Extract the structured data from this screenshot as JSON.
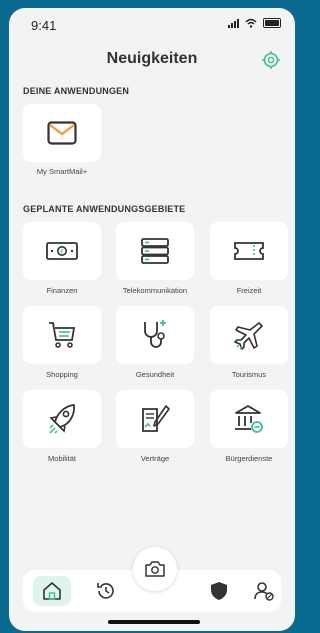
{
  "status": {
    "time": "9:41"
  },
  "header": {
    "title": "Neuigkeiten",
    "settings_icon": "gear-icon"
  },
  "sections": {
    "apps_title": "DEINE ANWENDUNGEN",
    "planned_title": "GEPLANTE ANWENDUNGSGEBIETE"
  },
  "apps": [
    {
      "label": "My SmartMail+",
      "icon": "mail-icon"
    }
  ],
  "planned": [
    {
      "label": "Finanzen",
      "icon": "money-icon"
    },
    {
      "label": "Telekommunikation",
      "icon": "server-icon"
    },
    {
      "label": "Freizeit",
      "icon": "ticket-icon"
    },
    {
      "label": "Shopping",
      "icon": "cart-icon"
    },
    {
      "label": "Gesundheit",
      "icon": "stethoscope-icon"
    },
    {
      "label": "Tourismus",
      "icon": "airplane-icon"
    },
    {
      "label": "Mobilität",
      "icon": "rocket-icon"
    },
    {
      "label": "Verträge",
      "icon": "contract-icon"
    },
    {
      "label": "Bürgerdienste",
      "icon": "government-icon"
    }
  ],
  "tabbar": {
    "items": [
      "home-icon",
      "history-icon",
      "camera-icon",
      "shield-icon",
      "user-settings-icon"
    ]
  },
  "colors": {
    "accent": "#3fbf8f",
    "mail": "#f2a23a",
    "background": "#f2f4f3",
    "frame": "#0b6a8f"
  }
}
